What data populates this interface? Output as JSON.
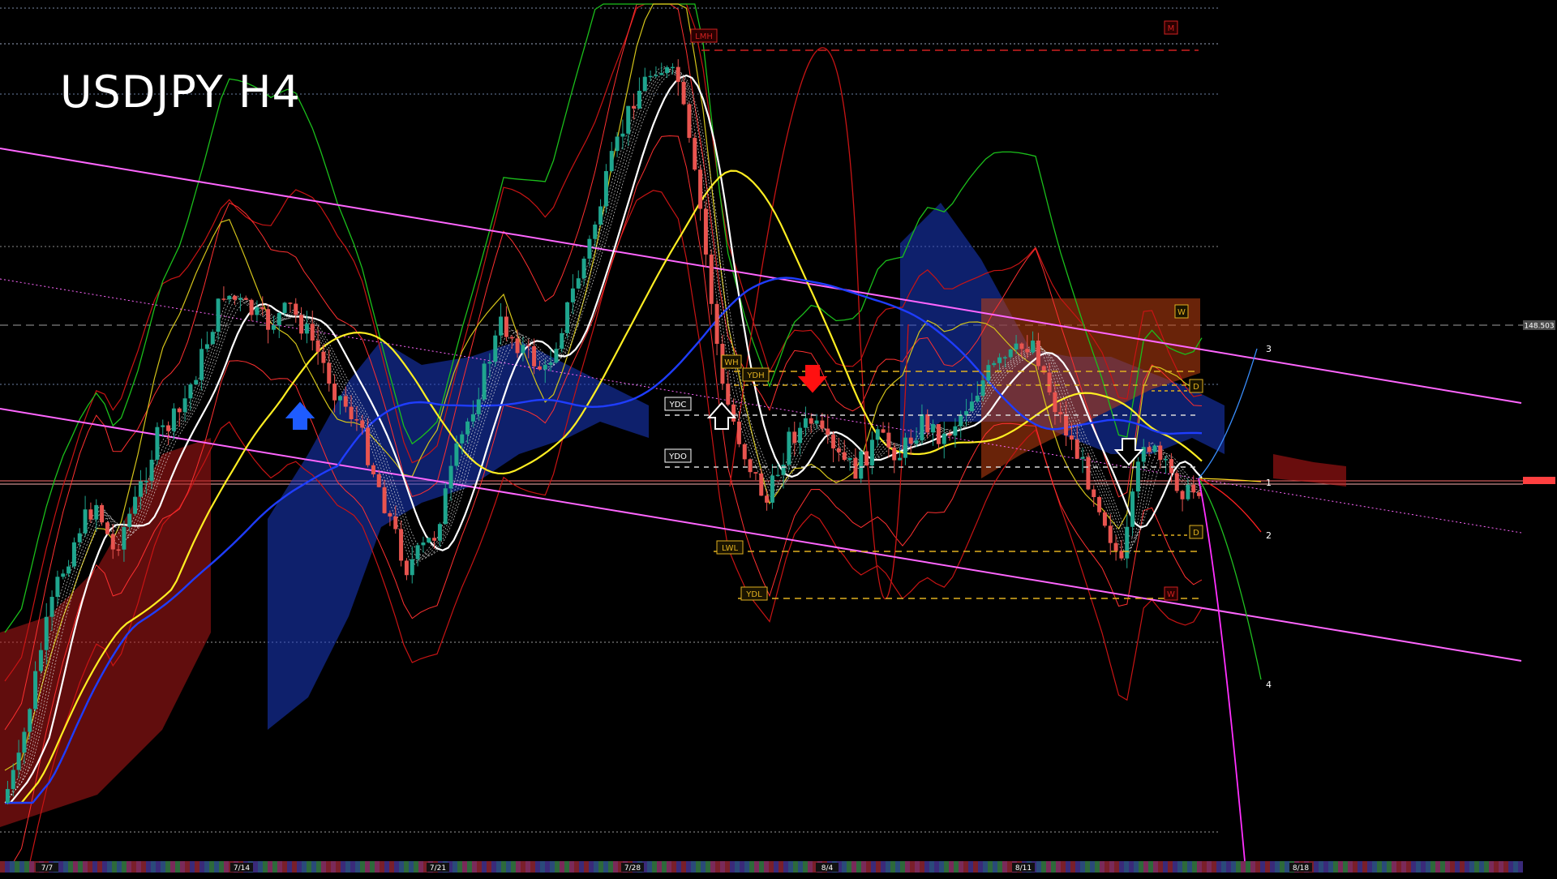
{
  "chart_data": {
    "type": "candlestick",
    "title": "USDJPY H4",
    "instrument": "USDJPY",
    "timeframe": "H4",
    "x_tick_labels": [
      "7/7",
      "7/14",
      "7/21",
      "7/28",
      "8/4",
      "8/11",
      "8/18"
    ],
    "price_label": "148.503",
    "level_labels": [
      "LMH",
      "M",
      "WH",
      "YDH",
      "YDC",
      "YDO",
      "LWL",
      "YDL",
      "W",
      "D",
      "D",
      "W"
    ],
    "projection_labels": [
      "1",
      "2",
      "3",
      "4"
    ],
    "arrow_signals": [
      {
        "direction": "up",
        "color": "#1e5cff",
        "near_tick": "7/14"
      },
      {
        "direction": "up",
        "color": "#ffffff",
        "near_tick": "7/28"
      },
      {
        "direction": "down",
        "color": "#ff1010",
        "near_tick": "8/4"
      },
      {
        "direction": "down",
        "color": "#ffffff",
        "near_tick": "8/11"
      }
    ],
    "colors": {
      "background": "#000000",
      "bull_candle": "#1fa58e",
      "bear_candle": "#e8544f",
      "channel": "#ff66ff",
      "ma_white": "#ffffff",
      "ma_yellow": "#ffee22",
      "ma_blue": "#1f3dff",
      "band_red": "#c81414",
      "band_green": "#1bbf1b",
      "band_yellow": "#d4c41a",
      "level_yellow": "#e0b020",
      "level_red": "#d02020"
    },
    "grid": false,
    "legend": "none"
  }
}
